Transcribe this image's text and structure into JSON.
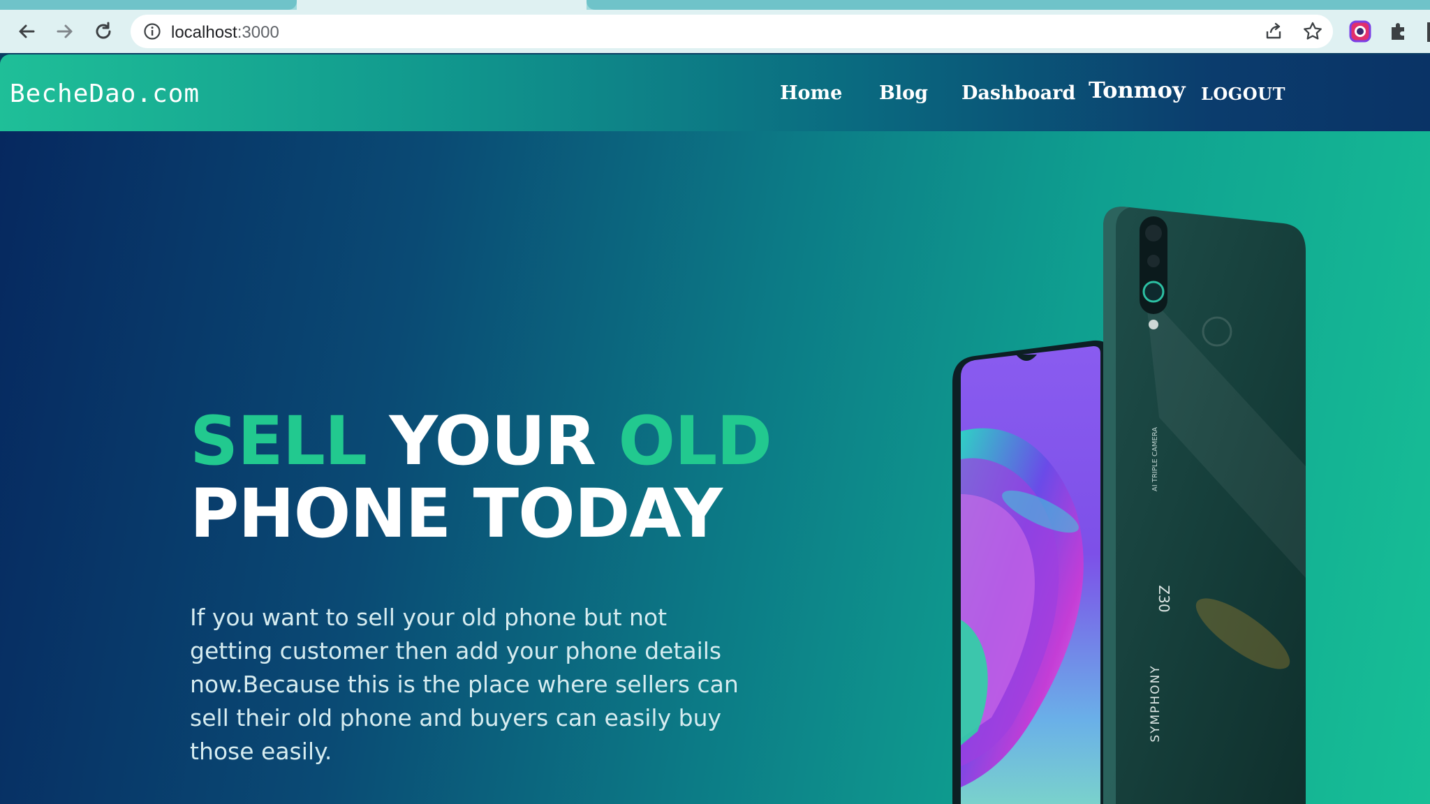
{
  "browser": {
    "url_host": "localhost",
    "url_port": ":3000",
    "icons": [
      "back-arrow-icon",
      "forward-arrow-icon",
      "reload-icon",
      "site-info-icon",
      "share-icon",
      "star-icon",
      "extension-profile-icon",
      "puzzle-extension-icon"
    ]
  },
  "navbar": {
    "brand": "BecheDao.com",
    "links": [
      "Home",
      "Blog",
      "Dashboard"
    ],
    "user_name": "Tonmoy",
    "logout_label": "LOGOUT"
  },
  "hero": {
    "headline": {
      "word1": "SELL",
      "word2": "YOUR",
      "word3": "OLD",
      "line2": "PHONE TODAY"
    },
    "description": "If you want to sell your old phone but not getting customer then add your phone details now.Because this is the place where sellers can sell their old phone and buyers can easily buy those easily.",
    "phone_image": {
      "side_text_1": "AI TRIPLE CAMERA",
      "side_text_2": "Z30",
      "side_text_3": "SYMPHONY"
    }
  },
  "colors": {
    "accent_green": "#22c98f",
    "nav_gradient_start": "#1fbf98",
    "nav_gradient_end": "#0a3366",
    "hero_dark": "#06285f",
    "hero_light": "#17bf96"
  }
}
